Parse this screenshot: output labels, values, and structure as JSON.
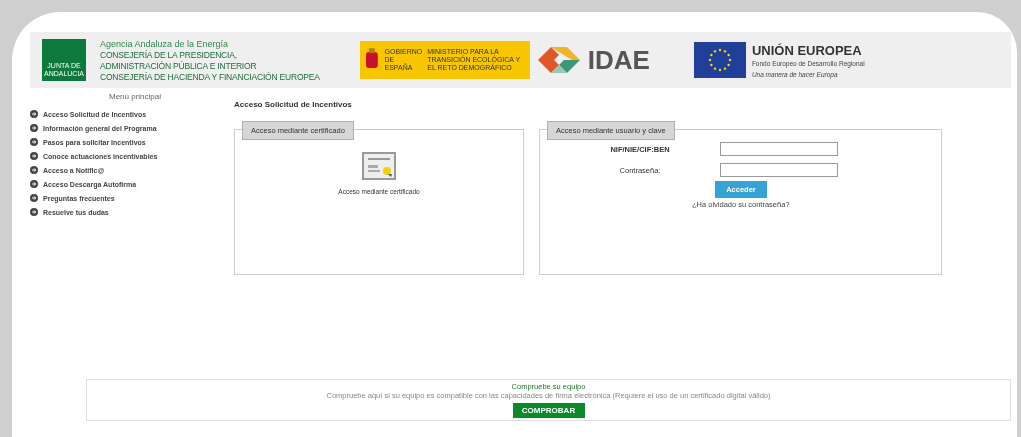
{
  "header": {
    "junta_label": "JUNTA DE ANDALUCIA",
    "agency": "Agencia Andaluza de la Energía",
    "consejerias": [
      "CONSEJERÍA DE LA PRESIDENCIA,",
      "ADMINISTRACIÓN PÚBLICA E INTERIOR",
      "CONSEJERÍA DE HACIENDA Y FINANCIACIÓN EUROPEA"
    ],
    "gobierno": "GOBIERNO DE ESPAÑA",
    "ministerio": "MINISTERIO PARA LA TRANSICIÓN ECOLÓGICA Y EL RETO DEMOGRÁFICO",
    "idae": "IDAE",
    "eu_title": "UNIÓN EUROPEA",
    "eu_fund": "Fondo Europeo de Desarrollo Regional",
    "eu_motto": "Una manera de hacer Europa"
  },
  "sidebar": {
    "title": "Menú principal",
    "items": [
      {
        "label": "Acceso Solicitud de Incentivos"
      },
      {
        "label": "Información general del Programa"
      },
      {
        "label": "Pasos para solicitar Incentivos"
      },
      {
        "label": "Conoce actuaciones incentivables"
      },
      {
        "label": "Acceso a Notific@"
      },
      {
        "label": "Acceso Descarga Autofirma"
      },
      {
        "label": "Preguntas frecuentes"
      },
      {
        "label": "Resuelve tus dudas"
      }
    ]
  },
  "main": {
    "title": "Acceso Solicitud de Incentivos",
    "certificate_panel": {
      "legend": "Acceso mediante certificado",
      "link": "Acceso mediante certificado"
    },
    "login_panel": {
      "legend": "Acceso mediante usuario y clave",
      "fields": [
        {
          "label": "NIF/NIE/CIF:BEN",
          "kind": "text"
        },
        {
          "label": "Contraseña:",
          "kind": "password"
        }
      ],
      "submit": "Acceder",
      "forgot": "¿Ha olvidado su contraseña?"
    }
  },
  "check": {
    "title": "Compruebe su equipo",
    "text": "Compruebe aquí si su equipo es compatible con las capacidades de firma electrónica (Requiere el uso de un certificado digital válido)",
    "button": "COMPROBAR"
  }
}
